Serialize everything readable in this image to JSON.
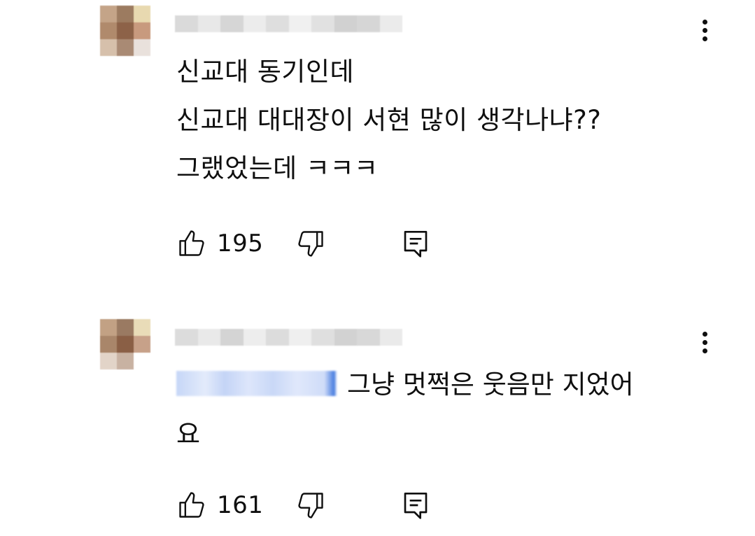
{
  "comments": [
    {
      "lines": [
        "신교대 동기인데",
        "신교대 대대장이 서현 많이 생각나냐??",
        "그랬었는데 ㅋㅋㅋ"
      ],
      "likes": "195",
      "like_icon": "thumbs-up-icon",
      "dislike_icon": "thumbs-down-icon",
      "reply_icon": "reply-icon",
      "menu_icon": "more-vert-icon"
    },
    {
      "mention_text": "",
      "lines": [
        "그냥 멋쩍은 웃음만 지었어",
        "요"
      ],
      "likes": "161",
      "like_icon": "thumbs-up-icon",
      "dislike_icon": "thumbs-down-icon",
      "reply_icon": "reply-icon",
      "menu_icon": "more-vert-icon"
    }
  ],
  "colors": {
    "text": "#0f0f0f",
    "background": "#ffffff",
    "mention": "#3ea6ff"
  }
}
